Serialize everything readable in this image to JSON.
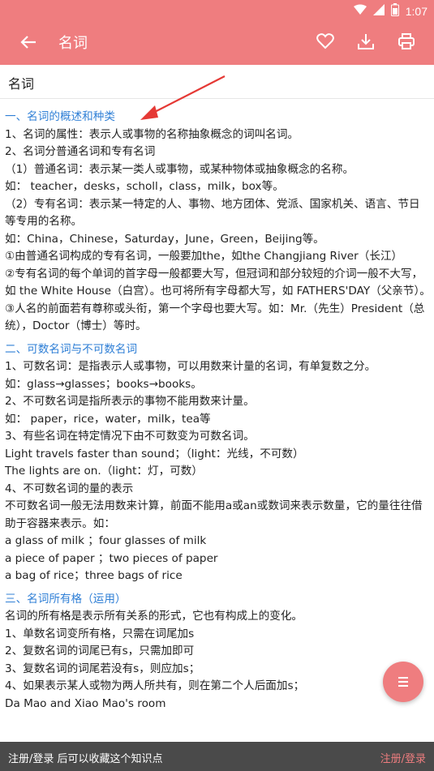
{
  "status_bar": {
    "time": "1:07"
  },
  "app_bar": {
    "title": "名词"
  },
  "subheader": {
    "title": "名词"
  },
  "content": [
    {
      "text": "一、名词的概述和种类",
      "heading": true
    },
    {
      "text": "1、名词的属性：表示人或事物的名称抽象概念的词叫名词。"
    },
    {
      "text": "2、名词分普通名词和专有名词"
    },
    {
      "text": "（1）普通名词：表示某一类人或事物，或某种物体或抽象概念的名称。"
    },
    {
      "text": "如： teacher，desks，scholl，class，milk，box等。"
    },
    {
      "text": "（2）专有名词：表示某一特定的人、事物、地方团体、党派、国家机关、语言、节日等专用的名称。"
    },
    {
      "text": "如：China，Chinese，Saturday，June，Green，Beijing等。"
    },
    {
      "text": "①由普通名词构成的专有名词，一般要加the，如the Changjiang River（长江）"
    },
    {
      "text": "②专有名词的每个单词的首字母一般都要大写，但冠词和部分较短的介词一般不大写，如 the White House（白宫）。也可将所有字母都大写，如 FATHERS'DAY（父亲节）。"
    },
    {
      "text": "③人名的前面若有尊称或头衔，第一个字母也要大写。如：Mr.（先生）President（总统），Doctor（博士）等时。"
    },
    {
      "text": "二、可数名词与不可数名词",
      "heading": true
    },
    {
      "text": "1、可数名词：是指表示人或事物，可以用数来计量的名词，有单复数之分。"
    },
    {
      "text": "如：glass→glasses；books→books。"
    },
    {
      "text": "2、不可数名词是指所表示的事物不能用数来计量。"
    },
    {
      "text": "如： paper，rice，water，milk，tea等"
    },
    {
      "text": "3、有些名词在特定情况下由不可数变为可数名词。"
    },
    {
      "text": "Light travels faster than sound；（light：光线，不可数）"
    },
    {
      "text": "The lights are on.（light：灯，可数）"
    },
    {
      "text": "4、不可数名词的量的表示"
    },
    {
      "text": "不可数名词一般无法用数来计算，前面不能用a或an或数词来表示数量，它的量往往借助于容器来表示。如："
    },
    {
      "text": "a glass of milk ；four glasses of milk"
    },
    {
      "text": "a piece of paper ；two pieces of paper"
    },
    {
      "text": "a bag of rice；three bags of rice"
    },
    {
      "text": "三、名词所有格（运用）",
      "heading": true
    },
    {
      "text": "名词的所有格是表示所有关系的形式，它也有构成上的变化。"
    },
    {
      "text": "1、单数名词变所有格，只需在词尾加s"
    },
    {
      "text": "2、复数名词的词尾已有s，只需加即可"
    },
    {
      "text": "3、复数名词的词尾若没有s，则应加s；"
    },
    {
      "text": "4、如果表示某人或物为两人所共有，则在第二个人后面加s；"
    },
    {
      "text": "Da Mao and Xiao Mao's room"
    }
  ],
  "fab": {
    "icon": "menu-icon"
  },
  "bottom_bar": {
    "message": "注册/登录 后可以收藏这个知识点",
    "action": "注册/登录"
  },
  "colors": {
    "accent": "#ef7d7f",
    "heading": "#2f7fd6",
    "bottom_bar": "#4a4a4a",
    "arrow": "#e53935"
  }
}
